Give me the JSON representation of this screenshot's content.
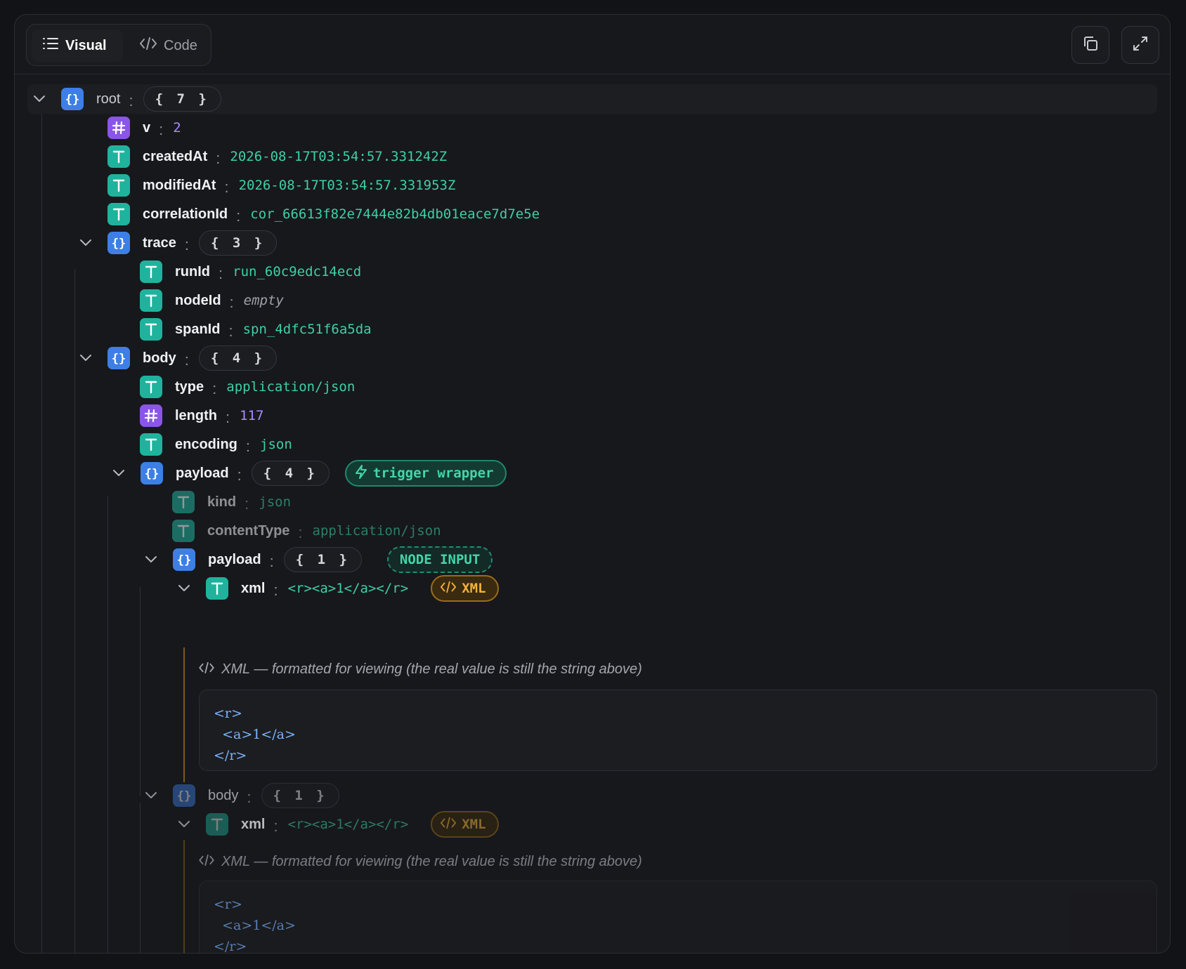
{
  "toolbar": {
    "visual_label": "Visual",
    "code_label": "Code"
  },
  "tree": {
    "root": {
      "key": "root",
      "count": "{ 7 }"
    },
    "v": {
      "key": "v",
      "value": "2"
    },
    "createdAt": {
      "key": "createdAt",
      "value": "2026-08-17T03:54:57.331242Z"
    },
    "modifiedAt": {
      "key": "modifiedAt",
      "value": "2026-08-17T03:54:57.331953Z"
    },
    "correlationId": {
      "key": "correlationId",
      "value": "cor_66613f82e7444e82b4db01eace7d7e5e"
    },
    "trace": {
      "key": "trace",
      "count": "{ 3 }",
      "runId": {
        "key": "runId",
        "value": "run_60c9edc14ecd"
      },
      "nodeId": {
        "key": "nodeId",
        "value": "empty"
      },
      "spanId": {
        "key": "spanId",
        "value": "spn_4dfc51f6a5da"
      }
    },
    "body": {
      "key": "body",
      "count": "{ 4 }",
      "type": {
        "key": "type",
        "value": "application/json"
      },
      "length": {
        "key": "length",
        "value": "117"
      },
      "encoding": {
        "key": "encoding",
        "value": "json"
      },
      "payload": {
        "key": "payload",
        "count": "{ 4 }",
        "badge": "trigger wrapper",
        "kind": {
          "key": "kind",
          "value": "json"
        },
        "contentType": {
          "key": "contentType",
          "value": "application/json"
        },
        "inner_payload": {
          "key": "payload",
          "count": "{ 1 }",
          "badge": "NODE INPUT",
          "xml": {
            "key": "xml",
            "value": "<r><a>1</a></r>",
            "badge": "XML"
          }
        },
        "inner_body": {
          "key": "body",
          "count": "{ 1 }",
          "xml": {
            "key": "xml",
            "value": "<r><a>1</a></r>",
            "badge": "XML"
          }
        }
      }
    }
  },
  "xml_note": "XML — formatted for viewing (the real value is still the string above)",
  "xml_formatted": [
    "<r>",
    "  <a>1</a>",
    "</r>"
  ],
  "colors": {
    "object": "#3d7fe6",
    "number": "#8a55e8",
    "string": "#1fb39d",
    "string_value": "#3ed0a4",
    "number_value": "#a98bff",
    "xml_accent": "#f0b23a"
  }
}
